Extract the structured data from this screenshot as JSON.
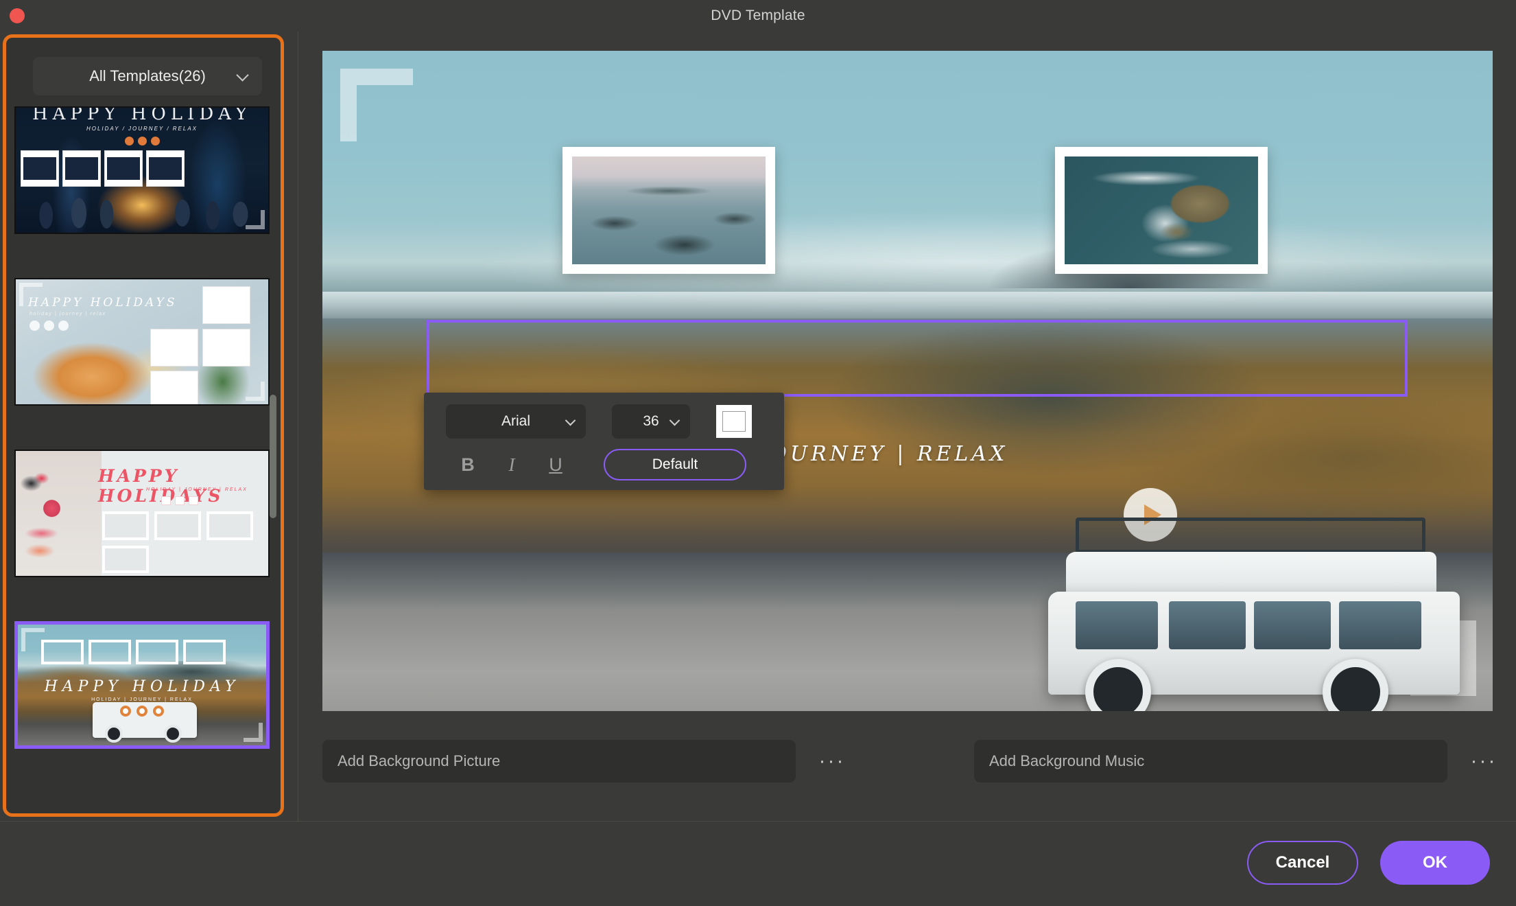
{
  "window": {
    "title": "DVD Template",
    "close_icon": "close-dot-icon"
  },
  "sidebar": {
    "filter": {
      "label": "All Templates(26)",
      "chevron_icon": "chevron-down-icon",
      "count": 26
    },
    "templates": [
      {
        "id": 1,
        "title": "HAPPY HOLIDAY",
        "subtitle": "HOLIDAY / JOURNEY / RELAX",
        "scene": "campfire-night",
        "frames": 4,
        "selected": false
      },
      {
        "id": 2,
        "title": "HAPPY HOLIDAYS",
        "subtitle": "holiday | journey | relax",
        "scene": "marble-food",
        "frames": 4,
        "selected": false
      },
      {
        "id": 3,
        "title": "HAPPY HOLIDAYS",
        "subtitle": "HOLIDAY | JOURNEY | RELAX",
        "scene": "fruit-light",
        "frames": 4,
        "selected": false
      },
      {
        "id": 4,
        "title": "HAPPY HOLIDAY",
        "subtitle": "HOLIDAY | JOURNEY | RELAX",
        "scene": "jeep-landscape",
        "frames": 4,
        "selected": true
      }
    ],
    "scrollbar_icon": "vertical-scrollbar"
  },
  "preview": {
    "subtitle_text": "LIDAY  |  JOURNEY  |  RELAX",
    "play_icon": "play-icon",
    "selection_box": "text-selection-box",
    "photos": [
      {
        "name": "islands-photo"
      },
      {
        "name": "coast-photo"
      }
    ]
  },
  "text_toolbar": {
    "font_family": "Arial",
    "font_size": "36",
    "color_hex": "#ffffff",
    "bold_label": "B",
    "italic_label": "I",
    "underline_label": "U",
    "default_label": "Default",
    "chevron_icon": "chevron-down-icon"
  },
  "bottom": {
    "background_picture_placeholder": "Add Background Picture",
    "background_music_placeholder": "Add Background Music",
    "more_label": "···"
  },
  "footer": {
    "cancel_label": "Cancel",
    "ok_label": "OK"
  },
  "colors": {
    "accent_purple": "#8a5cf5",
    "highlight_orange": "#e8721a",
    "window_bg": "#3a3a38",
    "close_red": "#f0564f"
  }
}
